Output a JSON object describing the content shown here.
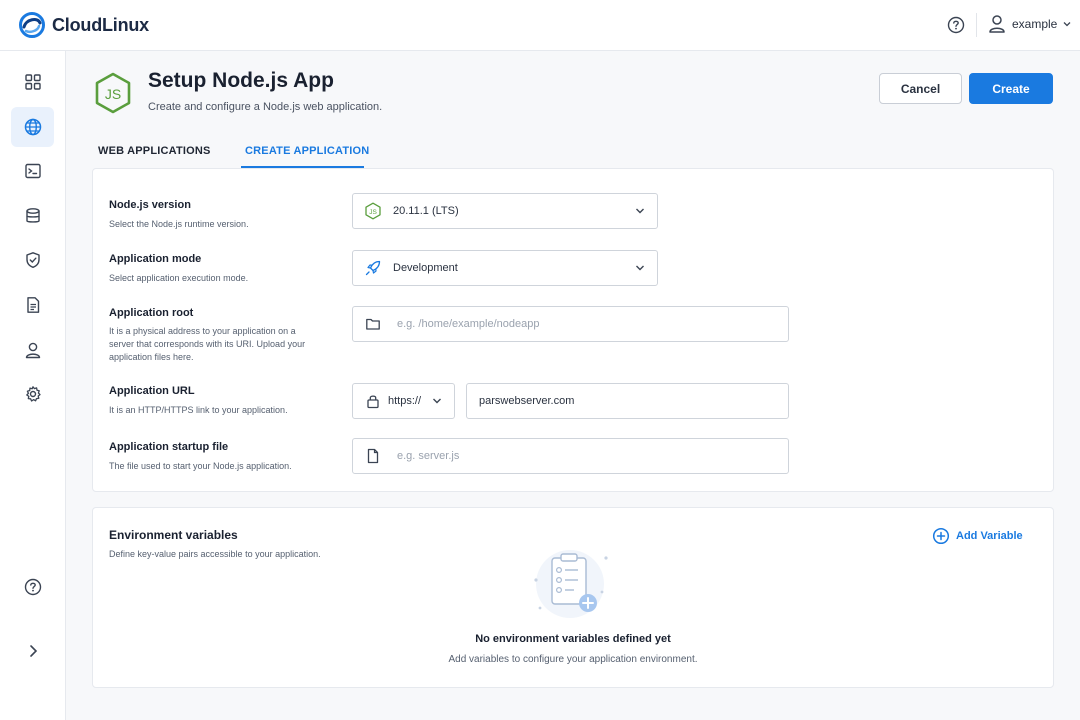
{
  "app": {
    "brand": "CloudLinux",
    "brand_color": "#1a7ae0",
    "accent_green": "#5a9e3d"
  },
  "topbar": {
    "help_icon": "help-circle-icon",
    "user_icon": "user-icon",
    "username": "example"
  },
  "sidebar": {
    "items": [
      {
        "icon": "dashboard-grid-icon",
        "active": false
      },
      {
        "icon": "globe-icon",
        "active": true
      },
      {
        "icon": "terminal-icon",
        "active": false
      },
      {
        "icon": "database-icon",
        "active": false
      },
      {
        "icon": "shield-check-icon",
        "active": false
      },
      {
        "icon": "document-icon",
        "active": false
      },
      {
        "icon": "user-icon",
        "active": false
      },
      {
        "icon": "gear-icon",
        "active": false
      }
    ],
    "bottom": [
      {
        "icon": "help-circle-icon"
      },
      {
        "icon": "chevron-right-icon"
      }
    ]
  },
  "header": {
    "title": "Setup Node.js App",
    "subtitle": "Create and configure a Node.js web application.",
    "cancel_label": "Cancel",
    "create_label": "Create"
  },
  "tabs": [
    {
      "label": "WEB APPLICATIONS",
      "active": false
    },
    {
      "label": "CREATE APPLICATION",
      "active": true
    }
  ],
  "form": {
    "node_version": {
      "label": "Node.js version",
      "help": "Select the Node.js runtime version.",
      "value": "20.11.1 (LTS)",
      "icon": "nodejs-icon"
    },
    "app_mode": {
      "label": "Application mode",
      "help": "Select application execution mode.",
      "value": "Development",
      "icon": "rocket-icon"
    },
    "app_root": {
      "label": "Application root",
      "help": "It is a physical address to your application on a server that corresponds with its URI. Upload your application files here.",
      "placeholder": "e.g. /home/example/nodeapp",
      "icon": "folder-icon"
    },
    "app_url": {
      "label": "Application URL",
      "help": "It is an HTTP/HTTPS link to your application.",
      "protocol": "https://",
      "domain": "parswebserver.com",
      "icon": "lock-icon"
    },
    "startup_file": {
      "label": "Application startup file",
      "help": "The file used to start your Node.js application.",
      "placeholder": "e.g. server.js",
      "icon": "file-icon"
    }
  },
  "env": {
    "title": "Environment variables",
    "help": "Define key-value pairs accessible to your application.",
    "add_label": "Add Variable",
    "empty_title": "No environment variables defined yet",
    "empty_sub": "Add variables to configure your application environment."
  }
}
